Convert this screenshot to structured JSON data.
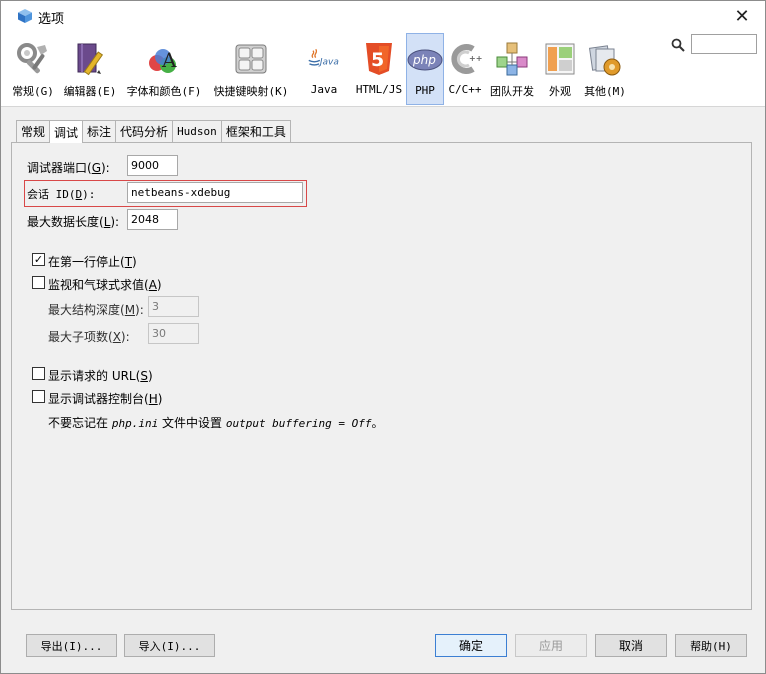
{
  "window": {
    "title": "选项",
    "close_glyph": "✕"
  },
  "toolbar": {
    "categories": [
      {
        "label": "常规(G)",
        "icon": "general-tools-icon"
      },
      {
        "label": "编辑器(E)",
        "icon": "editor-pencil-icon"
      },
      {
        "label": "字体和颜色(F)",
        "icon": "fonts-colors-icon"
      },
      {
        "label": "快捷键映射(K)",
        "icon": "keymap-icon"
      },
      {
        "label": "Java",
        "icon": "java-icon"
      },
      {
        "label": "HTML/JS",
        "icon": "html5-icon"
      },
      {
        "label": "PHP",
        "icon": "php-icon"
      },
      {
        "label": "C/C++",
        "icon": "cpp-icon"
      },
      {
        "label": "团队开发",
        "icon": "team-icon"
      },
      {
        "label": "外观",
        "icon": "appearance-icon"
      },
      {
        "label": "其他(M)",
        "icon": "miscellaneous-icon"
      }
    ],
    "active_index": 6,
    "java_logo_text": "Java",
    "html5_logo_text": "5",
    "php_logo_text": "php",
    "search_value": ""
  },
  "tabs": [
    {
      "label": "常规"
    },
    {
      "label": "调试"
    },
    {
      "label": "标注"
    },
    {
      "label": "代码分析"
    },
    {
      "label": "Hudson"
    },
    {
      "label": "框架和工具"
    }
  ],
  "active_tab": 1,
  "debugger": {
    "port_label": "调试器端口(",
    "port_mnemonic": "G",
    "port_label_end": "):",
    "port_value": "9000",
    "session_label": "会话 ID(",
    "session_mnemonic": "D",
    "session_label_end": "):",
    "session_value": "netbeans-xdebug",
    "maxlen_label": "最大数据长度(",
    "maxlen_mnemonic": "L",
    "maxlen_label_end": "):",
    "maxlen_value": "2048",
    "stop_first_line": {
      "label": "在第一行停止(",
      "mnemonic": "T",
      "end": ")",
      "checked": true,
      "mark": "✓"
    },
    "watch": {
      "label": "监视和气球式求值(",
      "mnemonic": "A",
      "end": ")",
      "checked": false
    },
    "max_depth": {
      "label": "最大结构深度(",
      "mnemonic": "M",
      "end": "):",
      "value": "3"
    },
    "max_children": {
      "label": "最大子项数(",
      "mnemonic": "X",
      "end": "):",
      "value": "30"
    },
    "show_url": {
      "label": "显示请求的 URL(",
      "mnemonic": "S",
      "end": ")",
      "checked": false
    },
    "show_console": {
      "label": "显示调试器控制台(",
      "mnemonic": "H",
      "end": ")",
      "checked": false
    },
    "note_prefix": "不要忘记在 ",
    "note_file": "php.ini",
    "note_middle": " 文件中设置 ",
    "note_setting": "output buffering = Off",
    "note_end": "。"
  },
  "buttons": {
    "export": "导出(I)...",
    "import": "导入(I)...",
    "ok": "确定",
    "apply": "应用",
    "cancel": "取消",
    "help": "帮助(H)"
  }
}
